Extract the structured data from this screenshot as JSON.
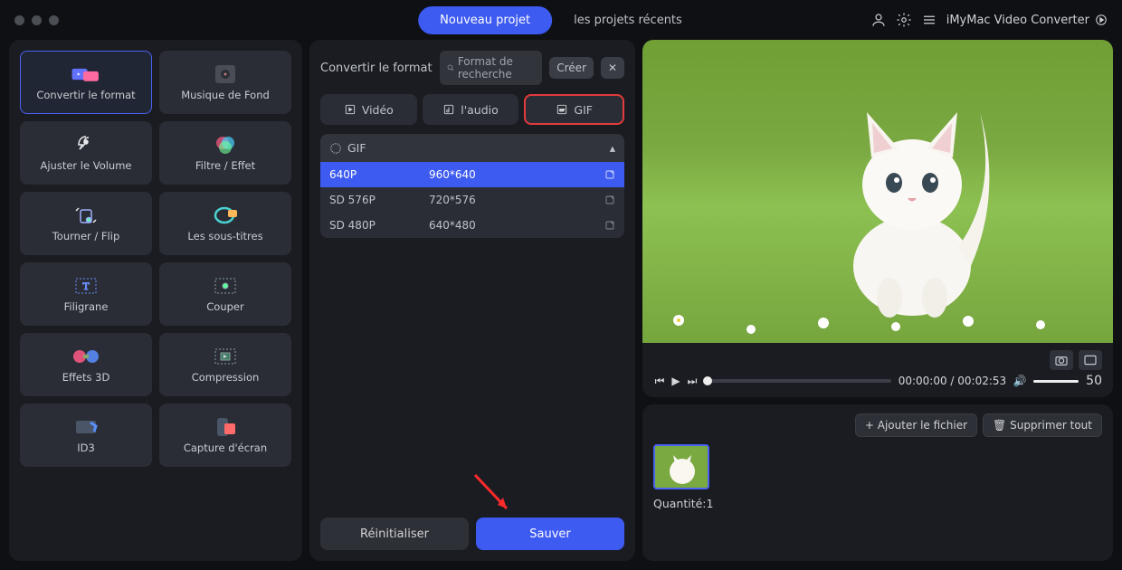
{
  "titlebar": {
    "new_project": "Nouveau projet",
    "recent_projects": "les projets récents",
    "app_name": "iMyMac Video Converter"
  },
  "sidebar": {
    "tools": [
      {
        "label": "Convertir le format"
      },
      {
        "label": "Musique de Fond"
      },
      {
        "label": "Ajuster le Volume"
      },
      {
        "label": "Filtre / Effet"
      },
      {
        "label": "Tourner / Flip"
      },
      {
        "label": "Les sous-titres"
      },
      {
        "label": "Filigrane"
      },
      {
        "label": "Couper"
      },
      {
        "label": "Effets 3D"
      },
      {
        "label": "Compression"
      },
      {
        "label": "ID3"
      },
      {
        "label": "Capture d'écran"
      }
    ]
  },
  "center": {
    "title": "Convertir le format",
    "search_placeholder": "Format de recherche",
    "create": "Créer",
    "tabs": {
      "video": "Vidéo",
      "audio": "l'audio",
      "gif": "GIF"
    },
    "group": "GIF",
    "rows": [
      {
        "res": "640P",
        "size": "960*640"
      },
      {
        "res": "SD 576P",
        "size": "720*576"
      },
      {
        "res": "SD 480P",
        "size": "640*480"
      }
    ],
    "reset": "Réinitialiser",
    "save": "Sauver"
  },
  "preview": {
    "time": "00:00:00 / 00:02:53",
    "volume": "50"
  },
  "filepanel": {
    "add": "Ajouter le fichier",
    "delete_all": "Supprimer tout",
    "qty": "Quantité:1"
  }
}
